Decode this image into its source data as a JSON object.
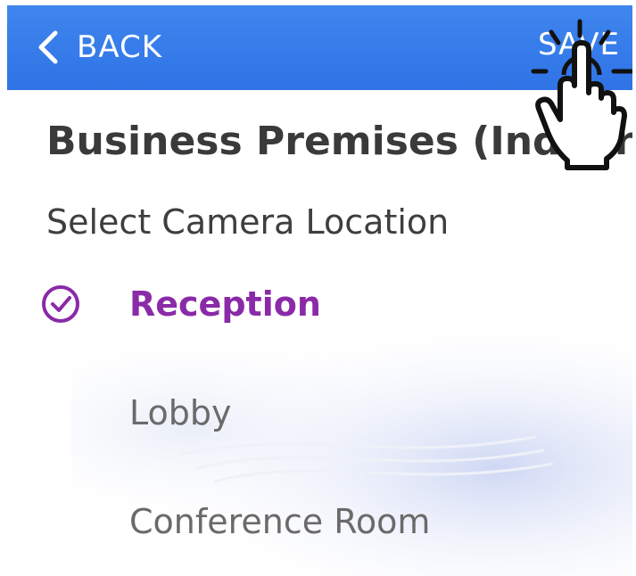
{
  "header": {
    "back_label": "BACK",
    "save_label": "SAVE",
    "color": "#3a80ec"
  },
  "page": {
    "title": "Business Premises (Indoor)",
    "subtitle": "Select Camera Location"
  },
  "locations": [
    {
      "label": "Reception",
      "selected": true
    },
    {
      "label": "Lobby",
      "selected": false
    },
    {
      "label": "Conference Room",
      "selected": false
    }
  ],
  "colors": {
    "selected": "#8a2aa8",
    "unselected": "#6a6a6a",
    "title": "#3a3a3a"
  },
  "icons": {
    "back": "chevron-left-icon",
    "check": "check-circle-icon",
    "tap": "tap-hand-icon"
  }
}
